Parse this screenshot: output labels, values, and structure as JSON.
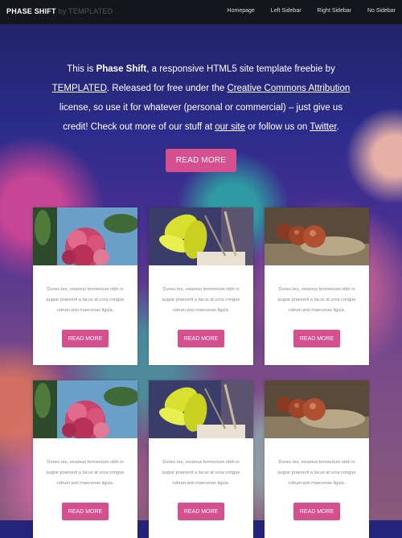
{
  "header": {
    "logo": "PHASE SHIFT",
    "logo_by": "by TEMPLATED",
    "nav": [
      "Homepage",
      "Left Sidebar",
      "Right Sidebar",
      "No Sidebar"
    ]
  },
  "intro": {
    "t1": "This is ",
    "brand": "Phase Shift",
    "t2": ", a responsive HTML5 site template freebie by ",
    "link_templated": "TEMPLATED",
    "t3": ". Released for free under the ",
    "link_license": "Creative Commons Attribution",
    "t4": " license, so use it for whatever (personal or commercial) – just give us credit! Check out more of our stuff at ",
    "link_site": "our site",
    "t5": " or follow us on ",
    "link_twitter": "Twitter",
    "t6": "."
  },
  "cta_label": "READ MORE",
  "cards": [
    {
      "text": "Donec leo, vivamus fermentum nibh in augue praesent a lacus at urna congue rutrum wisi maecenas ligula.",
      "button": "READ MORE",
      "image": "flower-red"
    },
    {
      "text": "Donec leo, vivamus fermentum nibh in augue praesent a lacus at urna congue rutrum wisi maecenas ligula.",
      "button": "READ MORE",
      "image": "leaves-yellow"
    },
    {
      "text": "Donec leo, vivamus fermentum nibh in augue praesent a lacus at urna congue rutrum wisi maecenas ligula.",
      "button": "READ MORE",
      "image": "seeds-brown"
    },
    {
      "text": "Donec leo, vivamus fermentum nibh in augue praesent a lacus at urna congue rutrum wisi maecenas ligula.",
      "button": "READ MORE",
      "image": "flower-red"
    },
    {
      "text": "Donec leo, vivamus fermentum nibh in augue praesent a lacus at urna congue rutrum wisi maecenas ligula.",
      "button": "READ MORE",
      "image": "leaves-yellow"
    },
    {
      "text": "Donec leo, vivamus fermentum nibh in augue praesent a lacus at urna congue rutrum wisi maecenas ligula.",
      "button": "READ MORE",
      "image": "seeds-brown"
    }
  ],
  "colors": {
    "accent": "#d64f8f",
    "header_bg": "#15161c"
  }
}
